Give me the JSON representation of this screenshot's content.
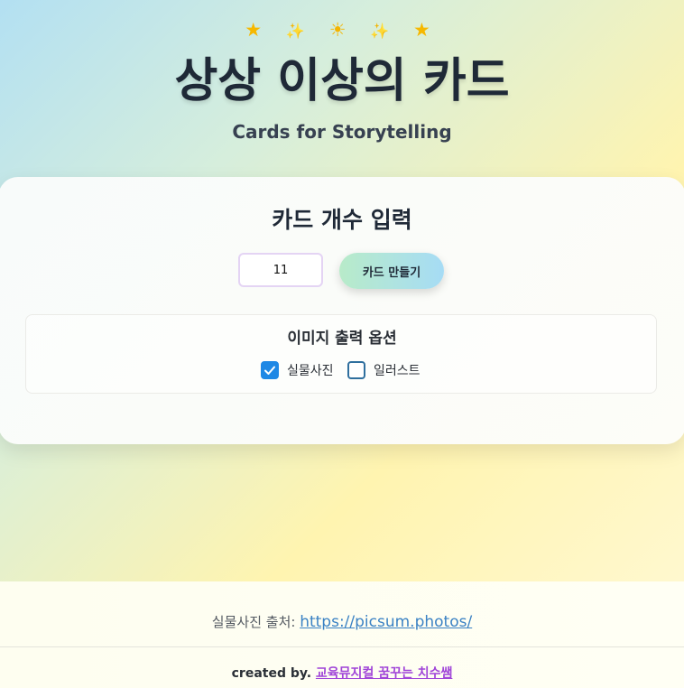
{
  "header": {
    "emojis": [
      {
        "icon": "star-icon",
        "glyph": "★",
        "color": "#f6b800"
      },
      {
        "icon": "sparkles-icon",
        "glyph": "✨",
        "color": "#f5c518"
      },
      {
        "icon": "sun-icon",
        "glyph": "☀",
        "color": "#f4b400"
      },
      {
        "icon": "sparkles-icon",
        "glyph": "✨",
        "color": "#f5c518"
      },
      {
        "icon": "star-icon",
        "glyph": "★",
        "color": "#f6b800"
      }
    ],
    "title": "상상 이상의 카드",
    "subtitle": "Cards for Storytelling"
  },
  "card": {
    "title": "카드 개수 입력",
    "count_input": {
      "value": "11",
      "placeholder": ""
    },
    "make_button_label": "카드 만들기",
    "options": {
      "title": "이미지 출력 옵션",
      "items": [
        {
          "label": "실물사진",
          "checked": true
        },
        {
          "label": "일러스트",
          "checked": false
        }
      ]
    }
  },
  "footer": {
    "photo_credit_prefix": "실물사진 출처: ",
    "photo_credit_link": "https://picsum.photos/",
    "created_by_prefix": "created by. ",
    "author_link": "교육뮤지컬 꿈꾸는 치수쌤"
  },
  "colors": {
    "accent_blue": "#1e88e5",
    "link_blue": "#3b82c4",
    "author_purple": "#a044d8"
  }
}
